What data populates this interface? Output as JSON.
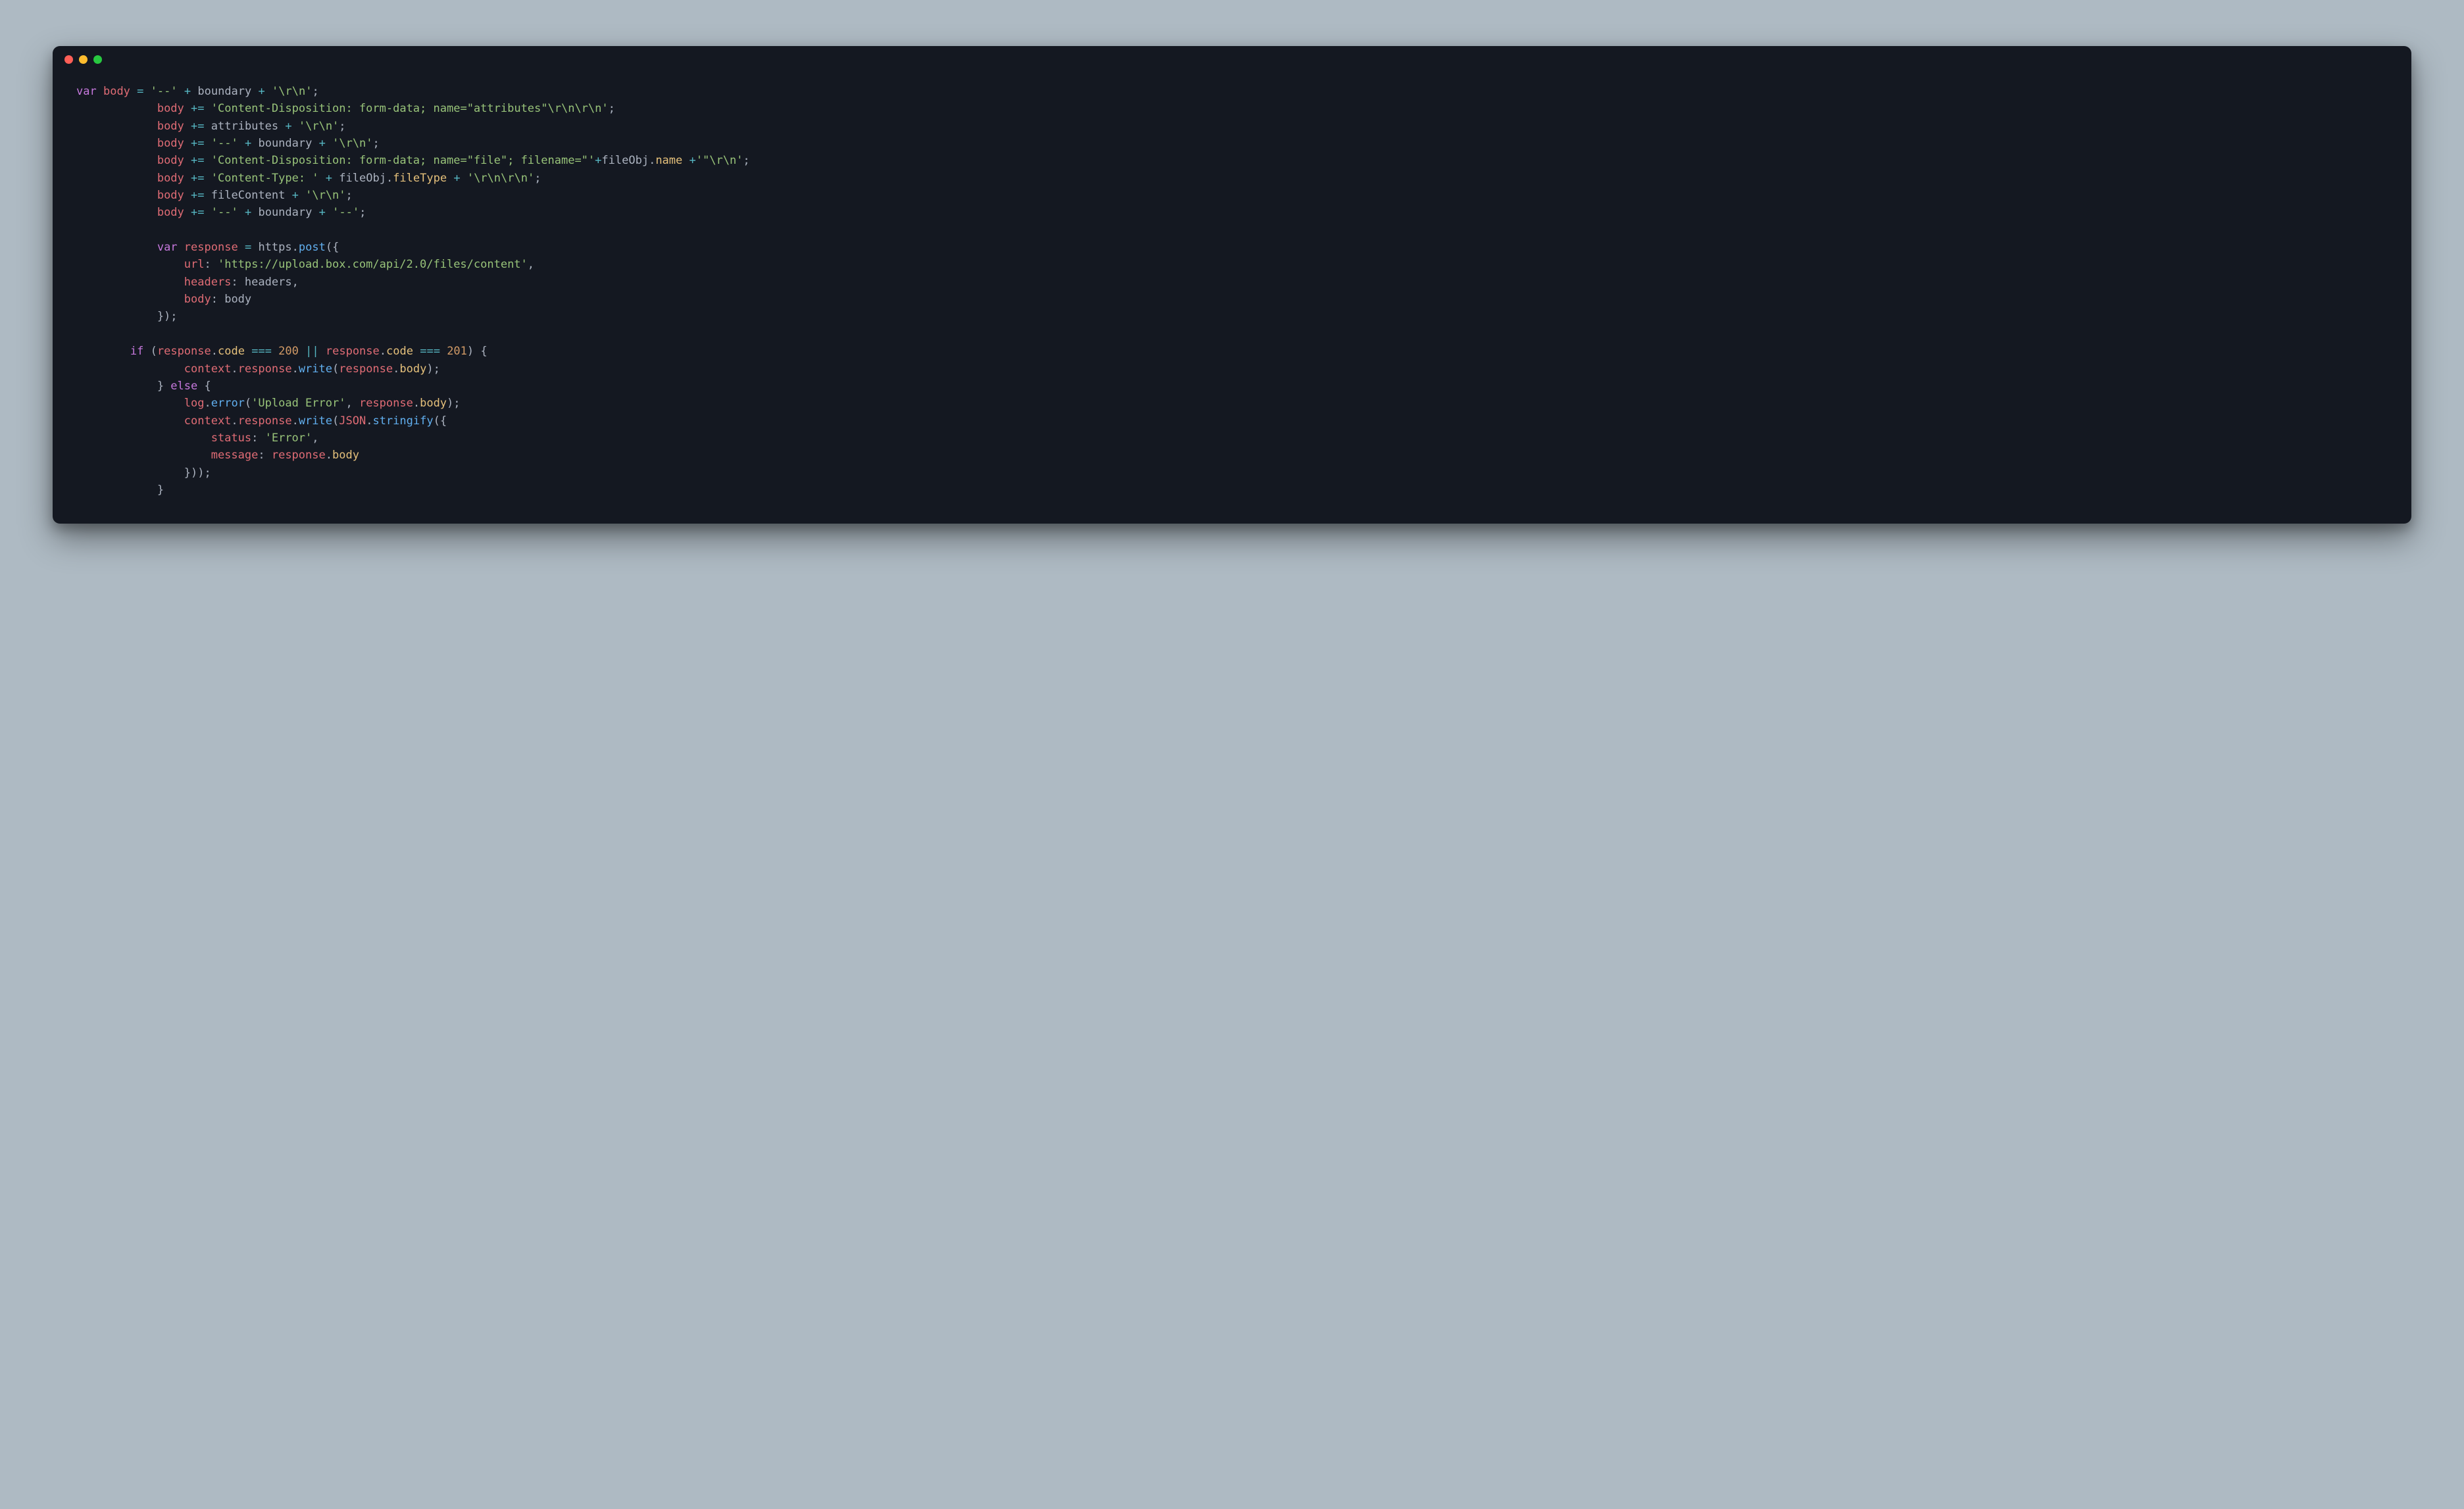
{
  "window": {
    "dots": [
      "red",
      "yellow",
      "green"
    ]
  },
  "code": {
    "tokens": [
      [
        [
          "kw",
          "var"
        ],
        [
          "pn",
          " "
        ],
        [
          "id",
          "body"
        ],
        [
          "pn",
          " "
        ],
        [
          "op",
          "="
        ],
        [
          "pn",
          " "
        ],
        [
          "str",
          "'--'"
        ],
        [
          "pn",
          " "
        ],
        [
          "op",
          "+"
        ],
        [
          "pn",
          " "
        ],
        [
          "pl",
          "boundary"
        ],
        [
          "pn",
          " "
        ],
        [
          "op",
          "+"
        ],
        [
          "pn",
          " "
        ],
        [
          "str",
          "'\\r\\n'"
        ],
        [
          "pn",
          ";"
        ]
      ],
      [
        [
          "pn",
          "            "
        ],
        [
          "id",
          "body"
        ],
        [
          "pn",
          " "
        ],
        [
          "op",
          "+="
        ],
        [
          "pn",
          " "
        ],
        [
          "str",
          "'Content-Disposition: form-data; name=\"attributes\"\\r\\n\\r\\n'"
        ],
        [
          "pn",
          ";"
        ]
      ],
      [
        [
          "pn",
          "            "
        ],
        [
          "id",
          "body"
        ],
        [
          "pn",
          " "
        ],
        [
          "op",
          "+="
        ],
        [
          "pn",
          " "
        ],
        [
          "pl",
          "attributes"
        ],
        [
          "pn",
          " "
        ],
        [
          "op",
          "+"
        ],
        [
          "pn",
          " "
        ],
        [
          "str",
          "'\\r\\n'"
        ],
        [
          "pn",
          ";"
        ]
      ],
      [
        [
          "pn",
          "            "
        ],
        [
          "id",
          "body"
        ],
        [
          "pn",
          " "
        ],
        [
          "op",
          "+="
        ],
        [
          "pn",
          " "
        ],
        [
          "str",
          "'--'"
        ],
        [
          "pn",
          " "
        ],
        [
          "op",
          "+"
        ],
        [
          "pn",
          " "
        ],
        [
          "pl",
          "boundary"
        ],
        [
          "pn",
          " "
        ],
        [
          "op",
          "+"
        ],
        [
          "pn",
          " "
        ],
        [
          "str",
          "'\\r\\n'"
        ],
        [
          "pn",
          ";"
        ]
      ],
      [
        [
          "pn",
          "            "
        ],
        [
          "id",
          "body"
        ],
        [
          "pn",
          " "
        ],
        [
          "op",
          "+="
        ],
        [
          "pn",
          " "
        ],
        [
          "str",
          "'Content-Disposition: form-data; name=\"file\"; filename=\"'"
        ],
        [
          "op",
          "+"
        ],
        [
          "pl",
          "fileObj"
        ],
        [
          "pn",
          "."
        ],
        [
          "prop",
          "name"
        ],
        [
          "pn",
          " "
        ],
        [
          "op",
          "+"
        ],
        [
          "str",
          "'\"\\r\\n'"
        ],
        [
          "pn",
          ";"
        ]
      ],
      [
        [
          "pn",
          "            "
        ],
        [
          "id",
          "body"
        ],
        [
          "pn",
          " "
        ],
        [
          "op",
          "+="
        ],
        [
          "pn",
          " "
        ],
        [
          "str",
          "'Content-Type: '"
        ],
        [
          "pn",
          " "
        ],
        [
          "op",
          "+"
        ],
        [
          "pn",
          " "
        ],
        [
          "pl",
          "fileObj"
        ],
        [
          "pn",
          "."
        ],
        [
          "prop",
          "fileType"
        ],
        [
          "pn",
          " "
        ],
        [
          "op",
          "+"
        ],
        [
          "pn",
          " "
        ],
        [
          "str",
          "'\\r\\n\\r\\n'"
        ],
        [
          "pn",
          ";"
        ]
      ],
      [
        [
          "pn",
          "            "
        ],
        [
          "id",
          "body"
        ],
        [
          "pn",
          " "
        ],
        [
          "op",
          "+="
        ],
        [
          "pn",
          " "
        ],
        [
          "pl",
          "fileContent"
        ],
        [
          "pn",
          " "
        ],
        [
          "op",
          "+"
        ],
        [
          "pn",
          " "
        ],
        [
          "str",
          "'\\r\\n'"
        ],
        [
          "pn",
          ";"
        ]
      ],
      [
        [
          "pn",
          "            "
        ],
        [
          "id",
          "body"
        ],
        [
          "pn",
          " "
        ],
        [
          "op",
          "+="
        ],
        [
          "pn",
          " "
        ],
        [
          "str",
          "'--'"
        ],
        [
          "pn",
          " "
        ],
        [
          "op",
          "+"
        ],
        [
          "pn",
          " "
        ],
        [
          "pl",
          "boundary"
        ],
        [
          "pn",
          " "
        ],
        [
          "op",
          "+"
        ],
        [
          "pn",
          " "
        ],
        [
          "str",
          "'--'"
        ],
        [
          "pn",
          ";"
        ]
      ],
      [],
      [
        [
          "pn",
          "            "
        ],
        [
          "kw",
          "var"
        ],
        [
          "pn",
          " "
        ],
        [
          "id",
          "response"
        ],
        [
          "pn",
          " "
        ],
        [
          "op",
          "="
        ],
        [
          "pn",
          " "
        ],
        [
          "pl",
          "https"
        ],
        [
          "pn",
          "."
        ],
        [
          "fn",
          "post"
        ],
        [
          "pn",
          "({"
        ]
      ],
      [
        [
          "pn",
          "                "
        ],
        [
          "id",
          "url"
        ],
        [
          "pn",
          ": "
        ],
        [
          "str",
          "'https://upload.box.com/api/2.0/files/content'"
        ],
        [
          "pn",
          ","
        ]
      ],
      [
        [
          "pn",
          "                "
        ],
        [
          "id",
          "headers"
        ],
        [
          "pn",
          ": "
        ],
        [
          "pl",
          "headers"
        ],
        [
          "pn",
          ","
        ]
      ],
      [
        [
          "pn",
          "                "
        ],
        [
          "id",
          "body"
        ],
        [
          "pn",
          ": "
        ],
        [
          "pl",
          "body"
        ]
      ],
      [
        [
          "pn",
          "            });"
        ]
      ],
      [],
      [
        [
          "pn",
          "        "
        ],
        [
          "kw",
          "if"
        ],
        [
          "pn",
          " ("
        ],
        [
          "id",
          "response"
        ],
        [
          "pn",
          "."
        ],
        [
          "prop",
          "code"
        ],
        [
          "pn",
          " "
        ],
        [
          "op",
          "==="
        ],
        [
          "pn",
          " "
        ],
        [
          "num",
          "200"
        ],
        [
          "pn",
          " "
        ],
        [
          "op",
          "||"
        ],
        [
          "pn",
          " "
        ],
        [
          "id",
          "response"
        ],
        [
          "pn",
          "."
        ],
        [
          "prop",
          "code"
        ],
        [
          "pn",
          " "
        ],
        [
          "op",
          "==="
        ],
        [
          "pn",
          " "
        ],
        [
          "num",
          "201"
        ],
        [
          "pn",
          ") {"
        ]
      ],
      [
        [
          "pn",
          "                "
        ],
        [
          "id",
          "context"
        ],
        [
          "pn",
          "."
        ],
        [
          "id",
          "response"
        ],
        [
          "pn",
          "."
        ],
        [
          "fn",
          "write"
        ],
        [
          "pn",
          "("
        ],
        [
          "id",
          "response"
        ],
        [
          "pn",
          "."
        ],
        [
          "prop",
          "body"
        ],
        [
          "pn",
          ");"
        ]
      ],
      [
        [
          "pn",
          "            } "
        ],
        [
          "kw",
          "else"
        ],
        [
          "pn",
          " {"
        ]
      ],
      [
        [
          "pn",
          "                "
        ],
        [
          "id",
          "log"
        ],
        [
          "pn",
          "."
        ],
        [
          "fn",
          "error"
        ],
        [
          "pn",
          "("
        ],
        [
          "str",
          "'Upload Error'"
        ],
        [
          "pn",
          ", "
        ],
        [
          "id",
          "response"
        ],
        [
          "pn",
          "."
        ],
        [
          "prop",
          "body"
        ],
        [
          "pn",
          ");"
        ]
      ],
      [
        [
          "pn",
          "                "
        ],
        [
          "id",
          "context"
        ],
        [
          "pn",
          "."
        ],
        [
          "id",
          "response"
        ],
        [
          "pn",
          "."
        ],
        [
          "fn",
          "write"
        ],
        [
          "pn",
          "("
        ],
        [
          "id",
          "JSON"
        ],
        [
          "pn",
          "."
        ],
        [
          "fn",
          "stringify"
        ],
        [
          "pn",
          "({"
        ]
      ],
      [
        [
          "pn",
          "                    "
        ],
        [
          "id",
          "status"
        ],
        [
          "pn",
          ": "
        ],
        [
          "str",
          "'Error'"
        ],
        [
          "pn",
          ","
        ]
      ],
      [
        [
          "pn",
          "                    "
        ],
        [
          "id",
          "message"
        ],
        [
          "pn",
          ": "
        ],
        [
          "id",
          "response"
        ],
        [
          "pn",
          "."
        ],
        [
          "prop",
          "body"
        ]
      ],
      [
        [
          "pn",
          "                }));"
        ]
      ],
      [
        [
          "pn",
          "            }"
        ]
      ]
    ]
  }
}
